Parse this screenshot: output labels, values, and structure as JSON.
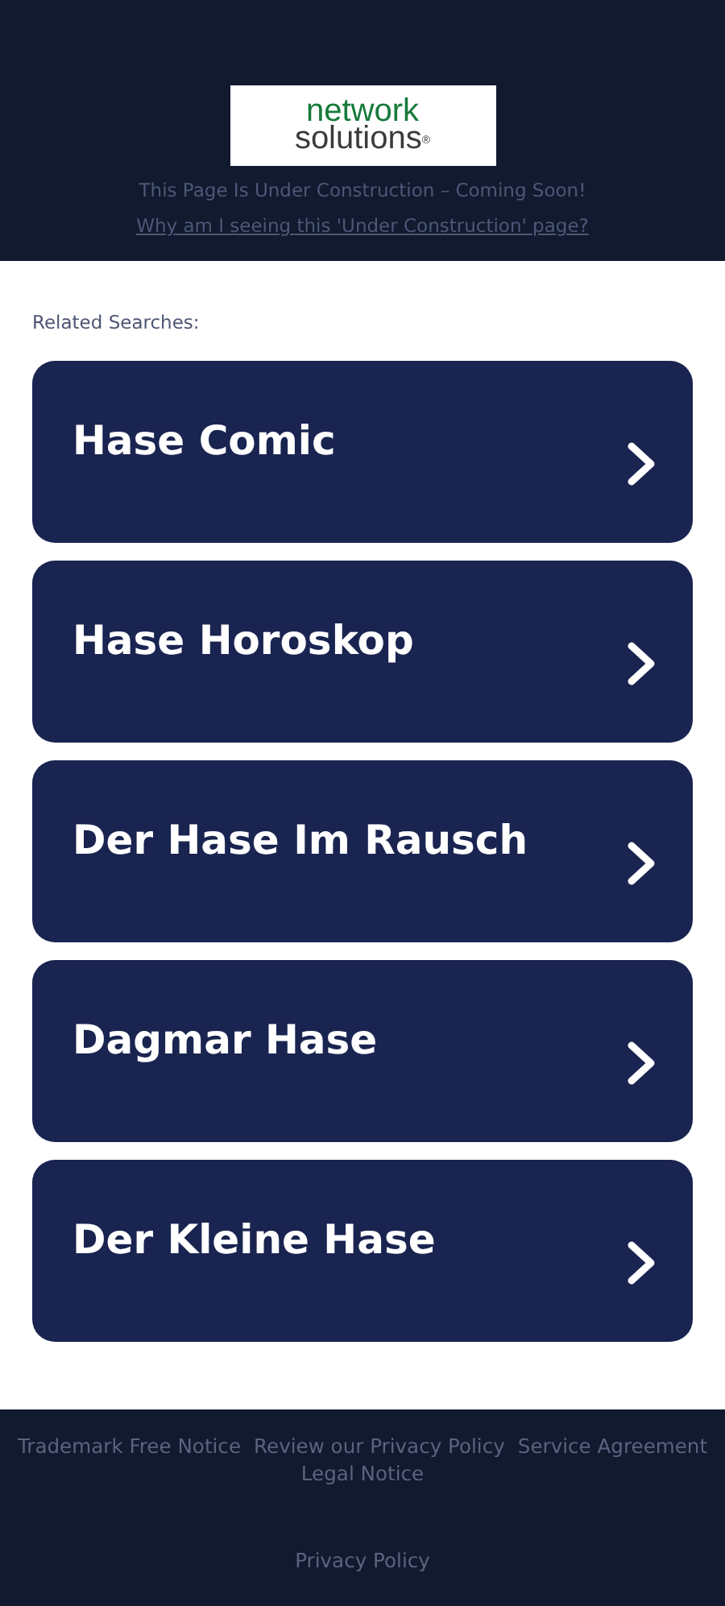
{
  "header": {
    "logo": {
      "line_1": "network",
      "line_2": "solutions",
      "mark": "®"
    },
    "notice": "This Page Is Under Construction – Coming Soon!",
    "link": "Why am I seeing this 'Under Construction' page?"
  },
  "related": {
    "title": "Related Searches:",
    "items": [
      {
        "label": "Hase Comic"
      },
      {
        "label": "Hase Horoskop"
      },
      {
        "label": "Der Hase Im Rausch"
      },
      {
        "label": "Dagmar Hase"
      },
      {
        "label": "Der Kleine Hase"
      }
    ]
  },
  "footer": {
    "links": [
      "Trademark Free Notice",
      "Review our Privacy Policy",
      "Service Agreement",
      "Legal Notice"
    ],
    "bottom_link": "Privacy Policy"
  }
}
